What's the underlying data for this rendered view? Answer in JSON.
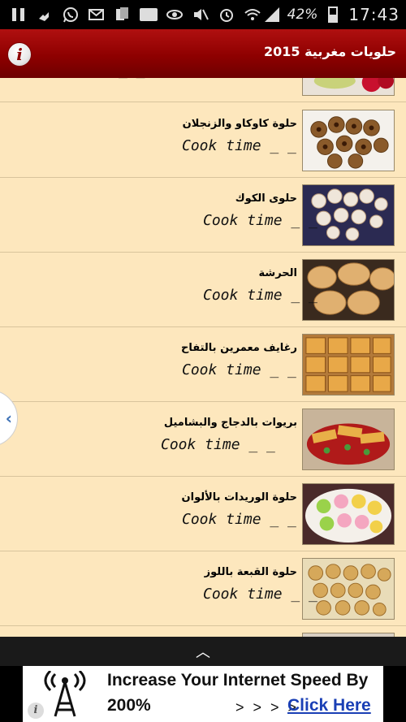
{
  "status_bar": {
    "battery": "42%",
    "time": "17:43",
    "icons": [
      "pause-icon",
      "phone-icon",
      "whatsapp-icon",
      "mail-icon",
      "sim-icon",
      "cnn-icon",
      "eye-icon",
      "mute-icon",
      "alarm-icon",
      "wifi-icon",
      "signal-icon"
    ],
    "cnn_label": "CNN"
  },
  "app_bar": {
    "title": "حلويات مغربية 2015",
    "info_label": "i"
  },
  "list": {
    "items": [
      {
        "title": "",
        "cook": "_ _",
        "image": "strawberry-cake-image"
      },
      {
        "title": "حلوة كاوكاو والزنجلان",
        "cook": "Cook time _ _",
        "image": "peanut-sesame-cookies-image"
      },
      {
        "title": "حلوى الكوك",
        "cook": "Cook time _ _",
        "image": "coconut-cookies-image"
      },
      {
        "title": "الحرشة",
        "cook": "Cook time _ _",
        "image": "harcha-bread-image"
      },
      {
        "title": "رغايف معمرين بالتفاح",
        "cook": "Cook time _ _",
        "image": "stuffed-pastry-apple-image"
      },
      {
        "title": "بريوات بالدجاج والبشاميل",
        "cook": "Cook time _ _",
        "image": "briouat-chicken-image"
      },
      {
        "title": "حلوة الوريدات بالألوان",
        "cook": "Cook time _ _",
        "image": "colored-flower-cookies-image"
      },
      {
        "title": "حلوة القبعة باللوز",
        "cook": "Cook time _ _",
        "image": "almond-hat-cookies-image"
      }
    ]
  },
  "side_tab": {
    "label": "‹"
  },
  "bottom_bar": {
    "label": "︿"
  },
  "ad": {
    "line1": "Increase Your Internet Speed By",
    "line2": "200%",
    "arrows": "> > > >",
    "link": "Click Here",
    "info": "i"
  },
  "colors": {
    "app_bar": "#8e0000",
    "list_bg": "#fde7bd",
    "link": "#1a3fb5"
  }
}
